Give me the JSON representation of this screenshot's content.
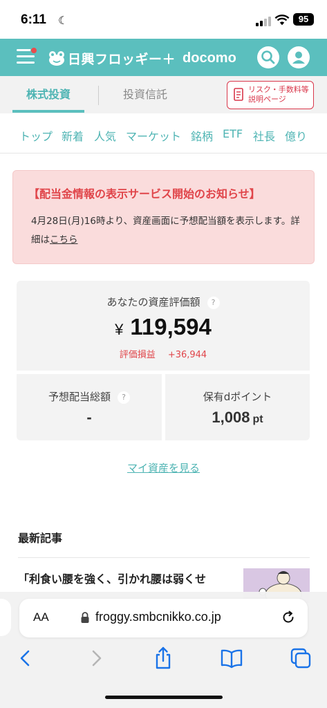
{
  "status_bar": {
    "time": "6:11",
    "battery": "95"
  },
  "header": {
    "logo_text": "日興フロッギー＋",
    "partner": "docomo"
  },
  "tabs": {
    "stock": "株式投資",
    "fund": "投資信託",
    "risk_line1": "リスク・手数料等",
    "risk_line2": "説明ページ"
  },
  "subnav": [
    "トップ",
    "新着",
    "人気",
    "マーケット",
    "銘柄",
    "ETF",
    "社長",
    "億り"
  ],
  "notice": {
    "title": "【配当金情報の表示サービス開始のお知らせ】",
    "body": "4月28日(月)16時より、資産画面に予想配当額を表示します。詳細は",
    "link": "こちら"
  },
  "assets": {
    "label": "あなたの資産評価額",
    "help": "?",
    "currency": "¥",
    "value": "119,594",
    "pl_label": "評価損益",
    "pl_value": "+36,944",
    "dividend_label": "予想配当総額",
    "dividend_value": "-",
    "points_label": "保有dポイント",
    "points_value": "1,008",
    "points_unit": "pt",
    "my_assets_link": "マイ資産を見る"
  },
  "articles": {
    "title": "最新記事",
    "first_title": "「利食い腰を強く、引かれ腰は弱くせ"
  },
  "browser": {
    "aa": "AA",
    "url": "froggy.smbcnikko.co.jp"
  }
}
